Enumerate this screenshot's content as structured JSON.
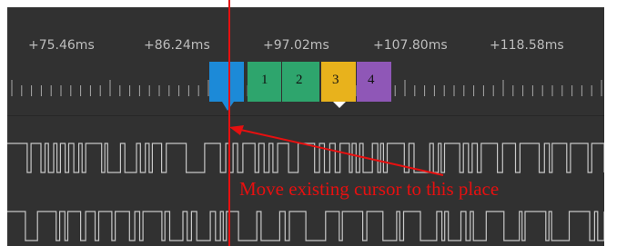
{
  "timeline": {
    "tick_labels": [
      "+75.46ms",
      "+86.24ms",
      "+97.02ms",
      "+107.80ms",
      "+118.58ms"
    ]
  },
  "cursors": [
    {
      "label": "",
      "color": "#1c8ad8"
    },
    {
      "label": "1",
      "color": "#2ea56d"
    },
    {
      "label": "2",
      "color": "#2ea56d"
    },
    {
      "label": "3",
      "color": "#e8b21c"
    },
    {
      "label": "4",
      "color": "#8f57b7"
    }
  ],
  "colors": {
    "background": "#313131",
    "signal": "#c8c8c8",
    "annotation": "#e61010"
  },
  "annotation": {
    "text": "Move existing cursor to this place"
  }
}
